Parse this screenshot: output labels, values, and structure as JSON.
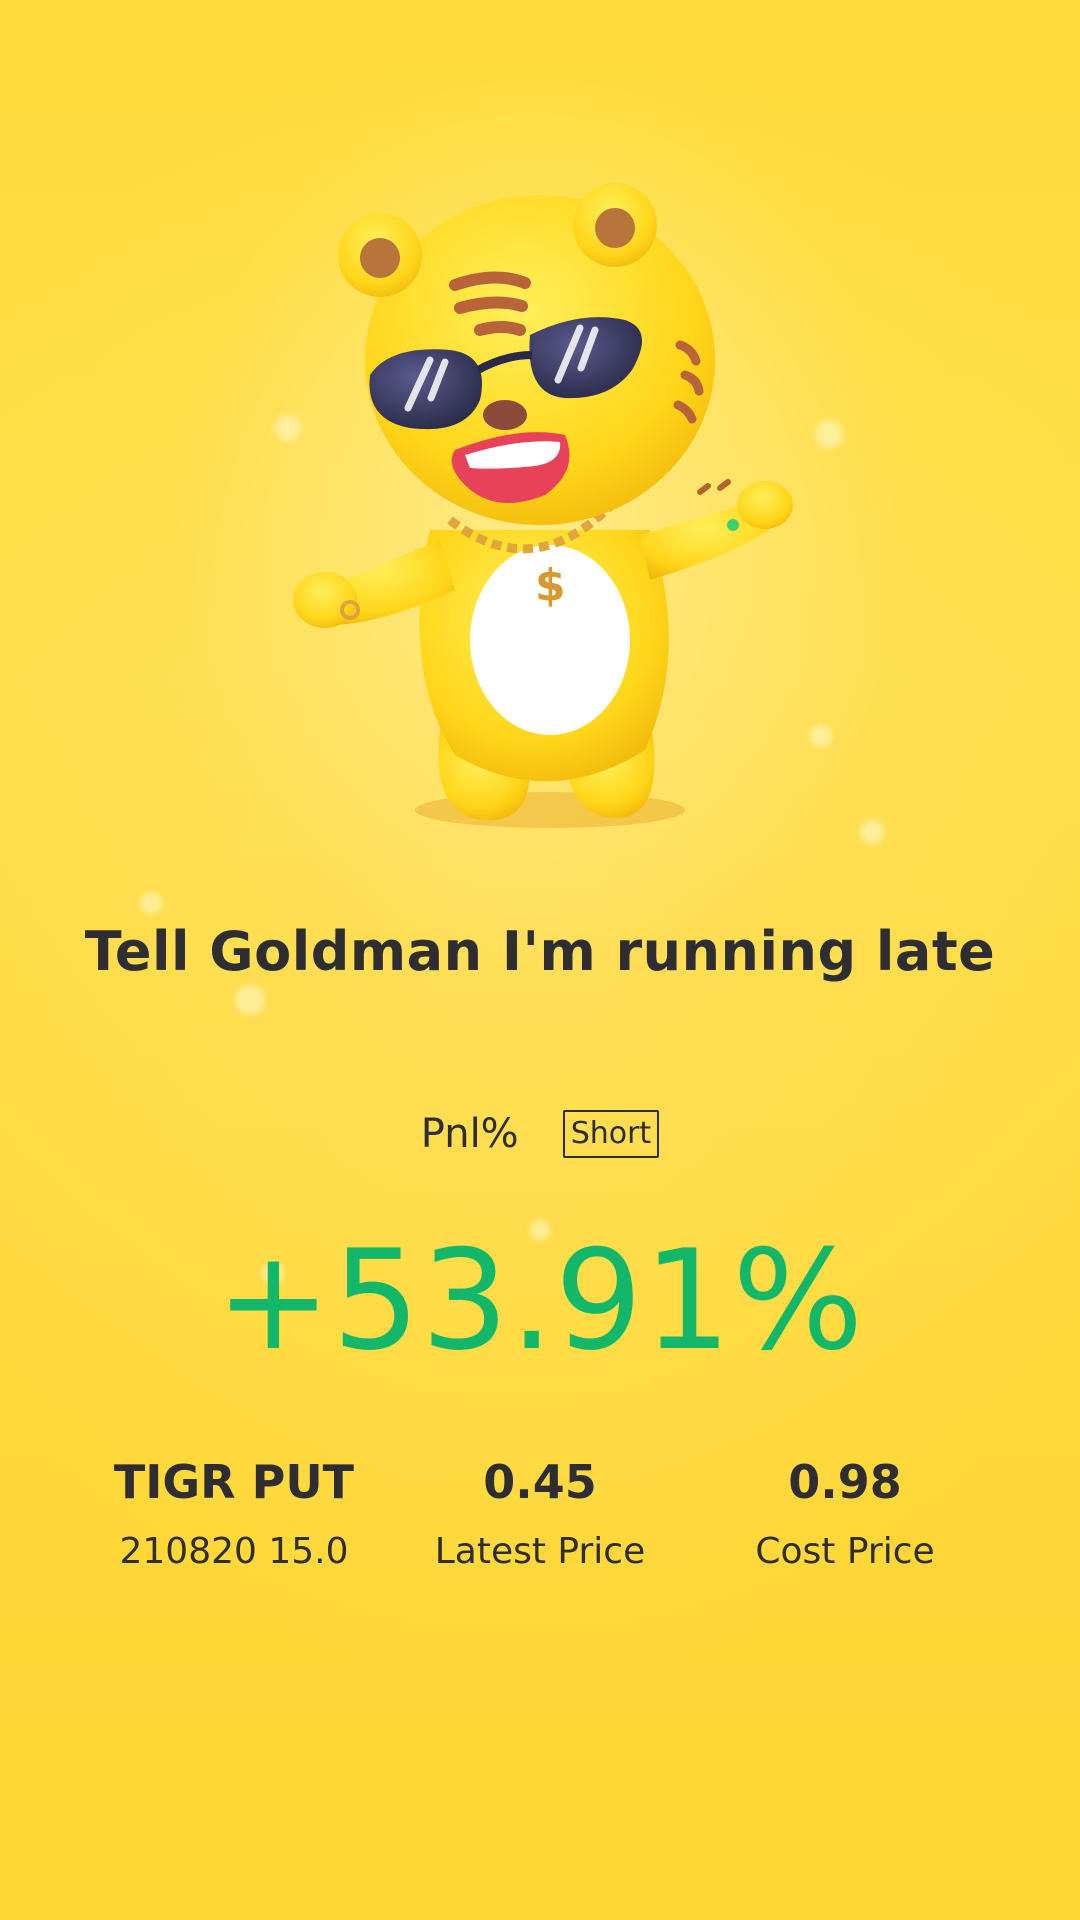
{
  "headline": "Tell Goldman I'm running late",
  "pnl": {
    "label": "Pnl%",
    "side": "Short",
    "value": "+53.91%"
  },
  "stats": {
    "instrument": {
      "symbol": "TIGR PUT",
      "contract": "210820 15.0"
    },
    "latest": {
      "value": "0.45",
      "label": "Latest Price"
    },
    "cost": {
      "value": "0.98",
      "label": "Cost Price"
    }
  },
  "mascot": {
    "icon": "tiger-mascot-icon"
  },
  "colors": {
    "background": "#ffdc3a",
    "text": "#2e2e32",
    "gain": "#12b76a"
  }
}
